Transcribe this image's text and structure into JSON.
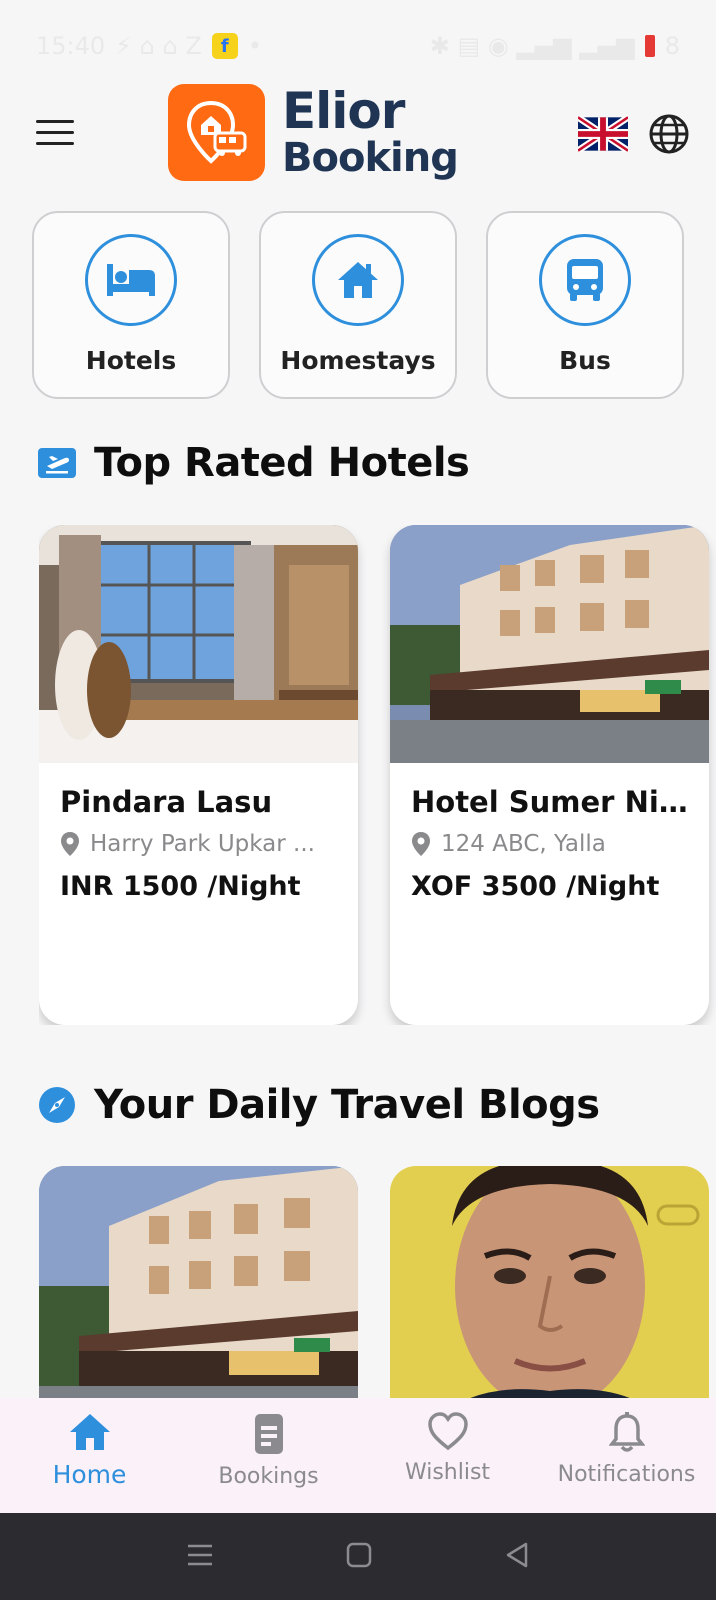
{
  "status_bar": {
    "time": "15:40",
    "battery_level": "8"
  },
  "header": {
    "logo_line1": "Elior",
    "logo_line2": "Booking",
    "brand_color": "#ff6a13",
    "logo_text_color": "#1f3553",
    "language_flag": "uk-flag-icon",
    "language_icon": "globe-icon"
  },
  "categories": [
    {
      "label": "Hotels",
      "icon": "bed-icon"
    },
    {
      "label": "Homestays",
      "icon": "house-icon"
    },
    {
      "label": "Bus",
      "icon": "bus-icon"
    }
  ],
  "top_rated": {
    "title": "Top Rated Hotels",
    "icon": "flight-ticket-icon",
    "hotels": [
      {
        "name": "Pindara Lasu",
        "location": "Harry Park Upkar ...",
        "price": "INR 1500 /Night"
      },
      {
        "name": "Hotel Sumer Niw...",
        "location": "124 ABC, Yalla",
        "price": "XOF 3500 /Night"
      }
    ]
  },
  "blogs": {
    "title": "Your Daily Travel Blogs",
    "icon": "compass-icon"
  },
  "bottom_nav": [
    {
      "label": "Home",
      "icon": "home-icon",
      "active": true
    },
    {
      "label": "Bookings",
      "icon": "bookings-icon",
      "active": false
    },
    {
      "label": "Wishlist",
      "icon": "heart-icon",
      "active": false
    },
    {
      "label": "Notifications",
      "icon": "bell-icon",
      "active": false
    }
  ],
  "accent_color": "#2e8fdc"
}
